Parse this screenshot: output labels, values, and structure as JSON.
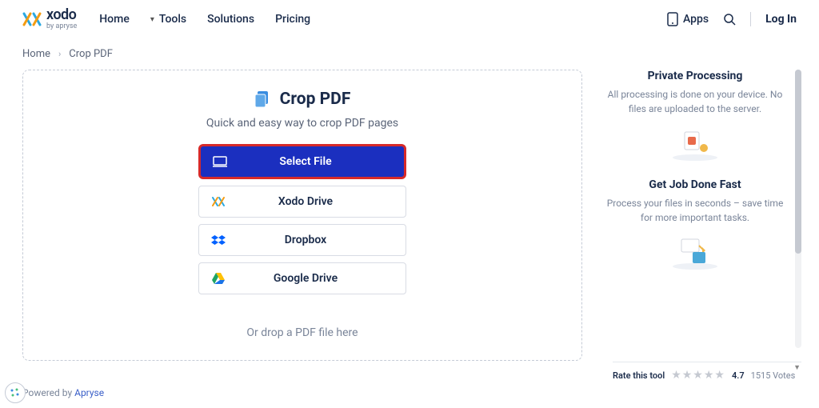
{
  "logo": {
    "name": "xodo",
    "sub": "by apryse"
  },
  "nav": {
    "home": "Home",
    "tools": "Tools",
    "solutions": "Solutions",
    "pricing": "Pricing"
  },
  "header": {
    "apps": "Apps",
    "login": "Log In"
  },
  "breadcrumb": {
    "home": "Home",
    "current": "Crop PDF"
  },
  "tool": {
    "title": "Crop PDF",
    "subtitle": "Quick and easy way to crop PDF pages",
    "select_file": "Select File",
    "xodo_drive": "Xodo Drive",
    "dropbox": "Dropbox",
    "google_drive": "Google Drive",
    "drop_hint": "Or drop a PDF file here"
  },
  "sidebar": {
    "block1": {
      "title": "Private Processing",
      "desc": "All processing is done on your device. No files are uploaded to the server."
    },
    "block2": {
      "title": "Get Job Done Fast",
      "desc": "Process your files in seconds – save time for more important tasks."
    }
  },
  "rating": {
    "label": "Rate this tool",
    "value": "4.7",
    "votes": "1515 Votes"
  },
  "footer": {
    "powered": "Powered by ",
    "brand": "Apryse"
  }
}
